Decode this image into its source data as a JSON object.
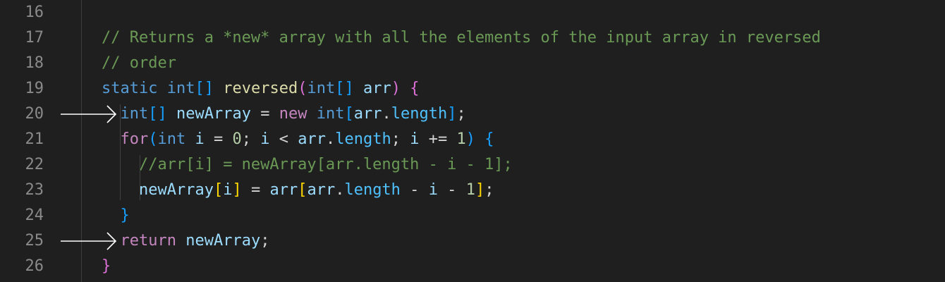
{
  "editor": {
    "lines": [
      {
        "number": "16",
        "tokens": []
      },
      {
        "number": "17",
        "tokens": [
          {
            "text": "// Returns a *new* array with all the elements of the input array in reversed",
            "kind": "comment"
          }
        ]
      },
      {
        "number": "18",
        "tokens": [
          {
            "text": "// order",
            "kind": "comment"
          }
        ]
      },
      {
        "number": "19",
        "tokens": [
          {
            "text": "static",
            "kind": "kw"
          },
          {
            "text": " ",
            "kind": "plain"
          },
          {
            "text": "int",
            "kind": "kw"
          },
          {
            "text": "[]",
            "kind": "p2"
          },
          {
            "text": " ",
            "kind": "plain"
          },
          {
            "text": "reversed",
            "kind": "fn"
          },
          {
            "text": "(",
            "kind": "p1"
          },
          {
            "text": "int",
            "kind": "kw"
          },
          {
            "text": "[]",
            "kind": "p2"
          },
          {
            "text": " ",
            "kind": "plain"
          },
          {
            "text": "arr",
            "kind": "var"
          },
          {
            "text": ")",
            "kind": "p1"
          },
          {
            "text": " ",
            "kind": "plain"
          },
          {
            "text": "{",
            "kind": "p1"
          }
        ]
      },
      {
        "number": "20",
        "tokens": [
          {
            "text": "  ",
            "kind": "plain"
          },
          {
            "text": "int",
            "kind": "kw"
          },
          {
            "text": "[]",
            "kind": "p2"
          },
          {
            "text": " ",
            "kind": "plain"
          },
          {
            "text": "newArray",
            "kind": "var"
          },
          {
            "text": " = ",
            "kind": "plain"
          },
          {
            "text": "new",
            "kind": "ctrl"
          },
          {
            "text": " ",
            "kind": "plain"
          },
          {
            "text": "int",
            "kind": "kw"
          },
          {
            "text": "[",
            "kind": "p2"
          },
          {
            "text": "arr",
            "kind": "var"
          },
          {
            "text": ".",
            "kind": "plain"
          },
          {
            "text": "length",
            "kind": "prop"
          },
          {
            "text": "]",
            "kind": "p2"
          },
          {
            "text": ";",
            "kind": "plain"
          }
        ]
      },
      {
        "number": "21",
        "tokens": [
          {
            "text": "  ",
            "kind": "plain"
          },
          {
            "text": "for",
            "kind": "ctrl"
          },
          {
            "text": "(",
            "kind": "p2"
          },
          {
            "text": "int",
            "kind": "kw"
          },
          {
            "text": " ",
            "kind": "plain"
          },
          {
            "text": "i",
            "kind": "var"
          },
          {
            "text": " = ",
            "kind": "plain"
          },
          {
            "text": "0",
            "kind": "num"
          },
          {
            "text": "; ",
            "kind": "plain"
          },
          {
            "text": "i",
            "kind": "var"
          },
          {
            "text": " < ",
            "kind": "plain"
          },
          {
            "text": "arr",
            "kind": "var"
          },
          {
            "text": ".",
            "kind": "plain"
          },
          {
            "text": "length",
            "kind": "prop"
          },
          {
            "text": "; ",
            "kind": "plain"
          },
          {
            "text": "i",
            "kind": "var"
          },
          {
            "text": " += ",
            "kind": "plain"
          },
          {
            "text": "1",
            "kind": "num"
          },
          {
            "text": ")",
            "kind": "p2"
          },
          {
            "text": " ",
            "kind": "plain"
          },
          {
            "text": "{",
            "kind": "p2"
          }
        ]
      },
      {
        "number": "22",
        "tokens": [
          {
            "text": "    ",
            "kind": "plain"
          },
          {
            "text": "//arr[i] = newArray[arr.length - i - 1];",
            "kind": "comment"
          }
        ]
      },
      {
        "number": "23",
        "tokens": [
          {
            "text": "    ",
            "kind": "plain"
          },
          {
            "text": "newArray",
            "kind": "var"
          },
          {
            "text": "[",
            "kind": "p3"
          },
          {
            "text": "i",
            "kind": "var"
          },
          {
            "text": "]",
            "kind": "p3"
          },
          {
            "text": " = ",
            "kind": "plain"
          },
          {
            "text": "arr",
            "kind": "var"
          },
          {
            "text": "[",
            "kind": "p3"
          },
          {
            "text": "arr",
            "kind": "var"
          },
          {
            "text": ".",
            "kind": "plain"
          },
          {
            "text": "length",
            "kind": "prop"
          },
          {
            "text": " - ",
            "kind": "plain"
          },
          {
            "text": "i",
            "kind": "var"
          },
          {
            "text": " - ",
            "kind": "plain"
          },
          {
            "text": "1",
            "kind": "num"
          },
          {
            "text": "]",
            "kind": "p3"
          },
          {
            "text": ";",
            "kind": "plain"
          }
        ]
      },
      {
        "number": "24",
        "tokens": [
          {
            "text": "  ",
            "kind": "plain"
          },
          {
            "text": "}",
            "kind": "p2"
          }
        ]
      },
      {
        "number": "25",
        "tokens": [
          {
            "text": "  ",
            "kind": "plain"
          },
          {
            "text": "return",
            "kind": "ctrl"
          },
          {
            "text": " ",
            "kind": "plain"
          },
          {
            "text": "newArray",
            "kind": "var"
          },
          {
            "text": ";",
            "kind": "plain"
          }
        ]
      },
      {
        "number": "26",
        "tokens": [
          {
            "text": "}",
            "kind": "p1"
          }
        ]
      }
    ],
    "arrow_lines": [
      "20",
      "25"
    ],
    "colors": {
      "background": "#1f1f1f",
      "line_number": "#8a8a8a",
      "comment": "#6a9955",
      "keyword": "#569cd6",
      "control": "#c586c0",
      "function": "#dcdcaa",
      "variable": "#9cdcfe",
      "number": "#b5cea8",
      "bracket_level1": "#da70d6",
      "bracket_level2": "#179fff",
      "bracket_level3": "#ffd700",
      "arrow": "#ffffff"
    },
    "icons": [
      "tab-arrow-icon"
    ]
  }
}
